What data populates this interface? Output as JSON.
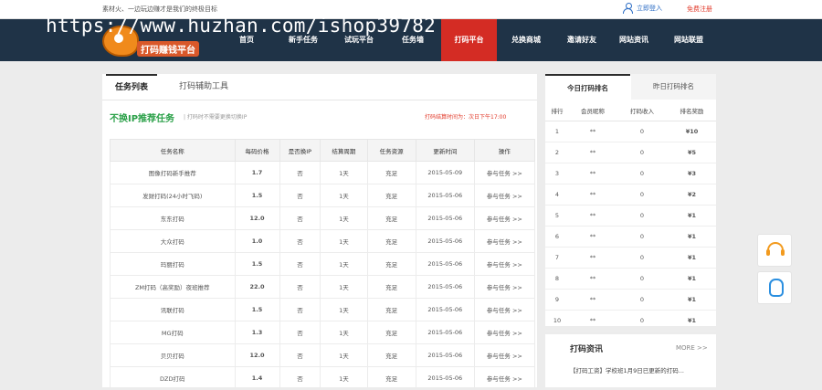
{
  "topbar": {
    "slogan": "素材火、一边玩边赚才是我们的终极目标",
    "login": "立即登入",
    "register": "免费注册"
  },
  "watermark": "https://www.huzhan.com/ishop39782",
  "logo": {
    "line1": "",
    "line2": "打码赚钱平台"
  },
  "nav": [
    {
      "label": "首页"
    },
    {
      "label": "新手任务"
    },
    {
      "label": "试玩平台"
    },
    {
      "label": "任务墙"
    },
    {
      "label": "打码平台"
    },
    {
      "label": "兑换商城"
    },
    {
      "label": "邀请好友"
    },
    {
      "label": "网站资讯"
    },
    {
      "label": "网站联盟"
    }
  ],
  "tabs": [
    "任务列表",
    "打码辅助工具"
  ],
  "section": {
    "title": "不换IP推荐任务",
    "note": "| 打码时不需要更换切换IP",
    "time": "打码结算时间为：次日下午17:00"
  },
  "task_headers": [
    "任务名称",
    "每码价格",
    "是否换IP",
    "结算周期",
    "任务资源",
    "更新时间",
    "操作"
  ],
  "tasks": [
    [
      "图像打码新手推荐",
      "1.7",
      "否",
      "1天",
      "充足",
      "2015-05-09",
      "参与任务 >>"
    ],
    [
      "发财打码(24小时飞码)",
      "1.5",
      "否",
      "1天",
      "充足",
      "2015-05-06",
      "参与任务 >>"
    ],
    [
      "东东打码",
      "12.0",
      "否",
      "1天",
      "充足",
      "2015-05-06",
      "参与任务 >>"
    ],
    [
      "大众打码",
      "1.0",
      "否",
      "1天",
      "充足",
      "2015-05-06",
      "参与任务 >>"
    ],
    [
      "玛丽打码",
      "1.5",
      "否",
      "1天",
      "充足",
      "2015-05-06",
      "参与任务 >>"
    ],
    [
      "ZM打码（高奖励）夜班推荐",
      "22.0",
      "否",
      "1天",
      "充足",
      "2015-05-06",
      "参与任务 >>"
    ],
    [
      "讯联打码",
      "1.5",
      "否",
      "1天",
      "充足",
      "2015-05-06",
      "参与任务 >>"
    ],
    [
      "MG打码",
      "1.3",
      "否",
      "1天",
      "充足",
      "2015-05-06",
      "参与任务 >>"
    ],
    [
      "贝贝打码",
      "12.0",
      "否",
      "1天",
      "充足",
      "2015-05-06",
      "参与任务 >>"
    ],
    [
      "DZD打码",
      "1.4",
      "否",
      "1天",
      "充足",
      "2015-05-06",
      "参与任务 >>"
    ]
  ],
  "rank_tabs": [
    "今日打码排名",
    "昨日打码排名"
  ],
  "rank_headers": [
    "排行",
    "会员昵称",
    "打码收入",
    "排名奖励"
  ],
  "ranks": [
    [
      "1",
      "**",
      "0",
      "¥10"
    ],
    [
      "2",
      "**",
      "0",
      "¥5"
    ],
    [
      "3",
      "**",
      "0",
      "¥3"
    ],
    [
      "4",
      "**",
      "0",
      "¥2"
    ],
    [
      "5",
      "**",
      "0",
      "¥1"
    ],
    [
      "6",
      "**",
      "0",
      "¥1"
    ],
    [
      "7",
      "**",
      "0",
      "¥1"
    ],
    [
      "8",
      "**",
      "0",
      "¥1"
    ],
    [
      "9",
      "**",
      "0",
      "¥1"
    ],
    [
      "10",
      "**",
      "0",
      "¥1"
    ]
  ],
  "news": {
    "title": "打码资讯",
    "more": "MORE >>",
    "line1": "【打码工资】学校班1月9日已更新的打码...",
    "line2": ""
  },
  "floating": [
    "headset-icon",
    "qq-icon"
  ]
}
